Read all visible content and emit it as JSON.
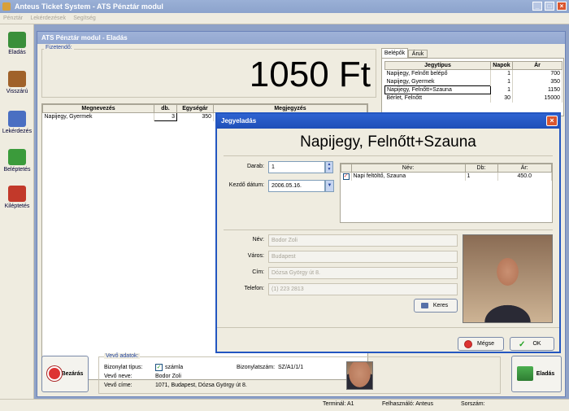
{
  "app": {
    "title": "Anteus Ticket System - ATS Pénztár modul",
    "menu": [
      "Pénztár",
      "Lekérdezések",
      "Segítség"
    ],
    "window_buttons": [
      "_",
      "□",
      "×"
    ]
  },
  "nav": [
    {
      "label": "Eladás",
      "icon": "cart-icon",
      "color": "#3a8f3a"
    },
    {
      "label": "Visszárú",
      "icon": "return-icon",
      "color": "#a0622a"
    },
    {
      "label": "Lekérdezés",
      "icon": "query-icon",
      "color": "#4a6fc2"
    },
    {
      "label": "Beléptetés",
      "icon": "enter-icon",
      "color": "#3b9b3b"
    },
    {
      "label": "Kiléptetés",
      "icon": "exit-icon",
      "color": "#c2392a"
    }
  ],
  "sale": {
    "title": "ATS Pénztár modul - Eladás",
    "payable_label": "Fizetendő:",
    "amount": "1050 Ft",
    "table_headers": [
      "Megnevezés",
      "db.",
      "Egységár",
      "Megjegyzés"
    ],
    "rows": [
      {
        "name": "Napijegy, Gyermek",
        "qty": "3",
        "unit": "350",
        "note": ""
      }
    ]
  },
  "tabs": [
    "Belépők",
    "Áruk"
  ],
  "ticket_table": {
    "headers": [
      "Jegytípus",
      "Napok",
      "Ár"
    ],
    "rows": [
      {
        "type": "Napijegy, Felnőtt belépő",
        "days": "1",
        "price": "700"
      },
      {
        "type": "Napijegy, Gyermek",
        "days": "1",
        "price": "350"
      },
      {
        "type": "Napijegy, Felnőtt+Szauna",
        "days": "1",
        "price": "1150"
      },
      {
        "type": "Bérlet, Felnőtt",
        "days": "30",
        "price": "15000"
      }
    ]
  },
  "dialog": {
    "title": "Jegyeladás",
    "heading": "Napijegy, Felnőtt+Szauna",
    "qty_label": "Darab:",
    "qty_value": "1",
    "start_label": "Kezdő dátum:",
    "start_value": "2006.05.16.",
    "sub_headers": [
      "Név:",
      "Db:",
      "Ár:"
    ],
    "sub_rows": [
      {
        "name": "Napi feltöltő, Szauna",
        "qty": "1",
        "price": "450.0",
        "checked": true
      }
    ],
    "name_label": "Név:",
    "name_value": "Bodor Zoli",
    "city_label": "Város:",
    "city_value": "Budapest",
    "address_label": "Cím:",
    "address_value": "Dózsa György út 8.",
    "phone_label": "Telefon:",
    "phone_value": "(1) 223 2813",
    "search_label": "Keres",
    "cancel_label": "Mégse",
    "ok_label": "OK"
  },
  "buyer": {
    "group_label": "Vevő adatok:",
    "receipt_type_label": "Bizonylat típus:",
    "invoice_label": "számla",
    "receipt_no_label": "Bizonylatszám:",
    "receipt_no": "SZ/A1/1/1",
    "buyer_name_label": "Vevő neve:",
    "buyer_name": "Bodor Zoli",
    "buyer_address_label": "Vevő címe:",
    "buyer_address": "1071, Budapest, Dózsa György út 8.",
    "close_label": "Bezárás",
    "sell_label": "Eladás"
  },
  "status": {
    "terminal": "Terminál: A1",
    "user": "Felhasználó: Anteus",
    "serial": "Sorszám:"
  },
  "colors": {
    "titlebar": "#8ca3cc",
    "dialog_title": "#2356c0",
    "amount": "#000000",
    "group_label": "#2546a0"
  }
}
